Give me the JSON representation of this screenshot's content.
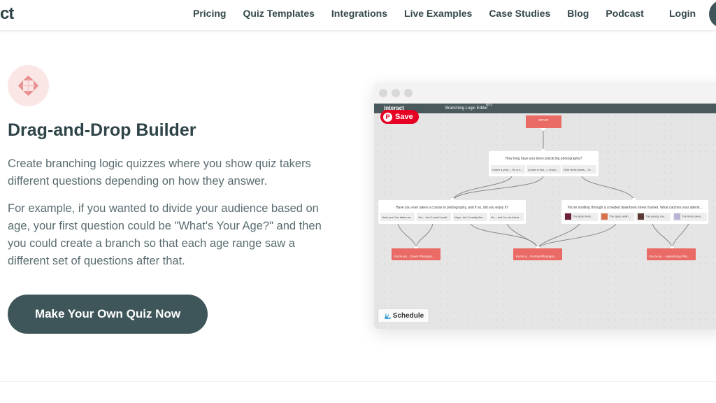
{
  "nav": {
    "logo": "ct",
    "links": [
      "Pricing",
      "Quiz Templates",
      "Integrations",
      "Live Examples",
      "Case Studies",
      "Blog",
      "Podcast"
    ],
    "login": "Login"
  },
  "hero": {
    "icon": "move-arrows-icon",
    "title": "Drag-and-Drop Builder",
    "para1": "Create branching logic quizzes where you show quiz takers different questions depending on how they answer.",
    "para2": "For example, if you wanted to divide your audience based on age, your first question could be \"What's Your Age?\" and then you could create a branch so that each age range saw a different set of questions after that.",
    "cta": "Make Your Own Quiz Now"
  },
  "editor": {
    "brand": "interact",
    "title": "Branching Logic Editor",
    "beta": "BETA",
    "save": "Save",
    "start": "START",
    "schedule": "Schedule",
    "q1": {
      "label": "QUESTION",
      "text": "How long have you been practicing photography?",
      "answers": [
        "Under a year -- I'm a n...",
        "A year or two -- I know...",
        "Over three years -- I'v..."
      ]
    },
    "q2": {
      "label": "QUESTION",
      "text": "Have you ever taken a course in photography, and if so, did you enjoy it?",
      "answers": [
        "Heck yes! I've taken se...",
        "Yes... but it wasn't reall...",
        "Nope, but I'd really like...",
        "No... and I'm not intere..."
      ]
    },
    "q3": {
      "label": "QUESTION",
      "text": "You're strolling through a crowded downtown street market. What catches your attenti...",
      "answers": [
        "The grey trans...",
        "The spice sellin...",
        "The young, ma...",
        "The birds swoo..."
      ]
    },
    "results": [
      {
        "label": "RESULT",
        "text": "You're an... Event Photogra..."
      },
      {
        "label": "RESULT",
        "text": "You're a... Portrait Photogra..."
      },
      {
        "label": "RESULT",
        "text": "You're an... Advertising Pho..."
      }
    ]
  },
  "colors": {
    "primary": "#3e5659",
    "accent": "#ea6a65",
    "pinterest": "#e60023"
  }
}
